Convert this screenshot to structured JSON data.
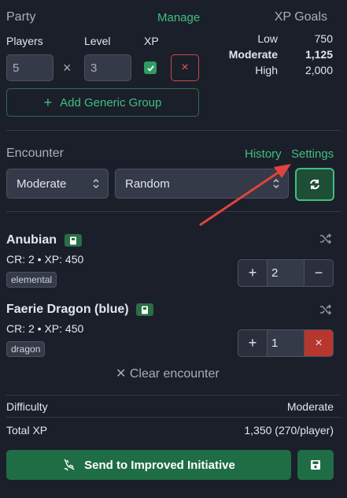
{
  "party": {
    "title": "Party",
    "manage_label": "Manage",
    "players_label": "Players",
    "level_label": "Level",
    "xp_label": "XP",
    "players_value": "5",
    "times_symbol": "×",
    "level_value": "3",
    "remove_symbol": "×",
    "add_group_label": "Add Generic Group",
    "add_group_plus": "+"
  },
  "xp_goals": {
    "title": "XP Goals",
    "rows": [
      {
        "name": "Low",
        "value": "750"
      },
      {
        "name": "Moderate",
        "value": "1,125"
      },
      {
        "name": "High",
        "value": "2,000"
      }
    ]
  },
  "encounter": {
    "title": "Encounter",
    "history_label": "History",
    "settings_label": "Settings",
    "difficulty_select": "Moderate",
    "type_select": "Random"
  },
  "monsters": [
    {
      "name": "Anubian",
      "stats": "CR: 2 • XP: 450",
      "tag": "elemental",
      "count": "2",
      "minus": "−"
    },
    {
      "name": "Faerie Dragon (blue)",
      "stats": "CR: 2 • XP: 450",
      "tag": "dragon",
      "count": "1",
      "remove": "×"
    }
  ],
  "clear_encounter_label": "✕ Clear encounter",
  "summary": {
    "difficulty_label": "Difficulty",
    "difficulty_value": "Moderate",
    "total_xp_label": "Total XP",
    "total_xp_value": "1,350 (270/player)"
  },
  "send_button_label": "Send to Improved Initiative",
  "colors": {
    "accent": "#3fbf7f",
    "danger": "#c44a4a",
    "primary_button": "#1f6d45",
    "background": "#1b1f2a",
    "annotation_arrow": "#e0443c"
  }
}
